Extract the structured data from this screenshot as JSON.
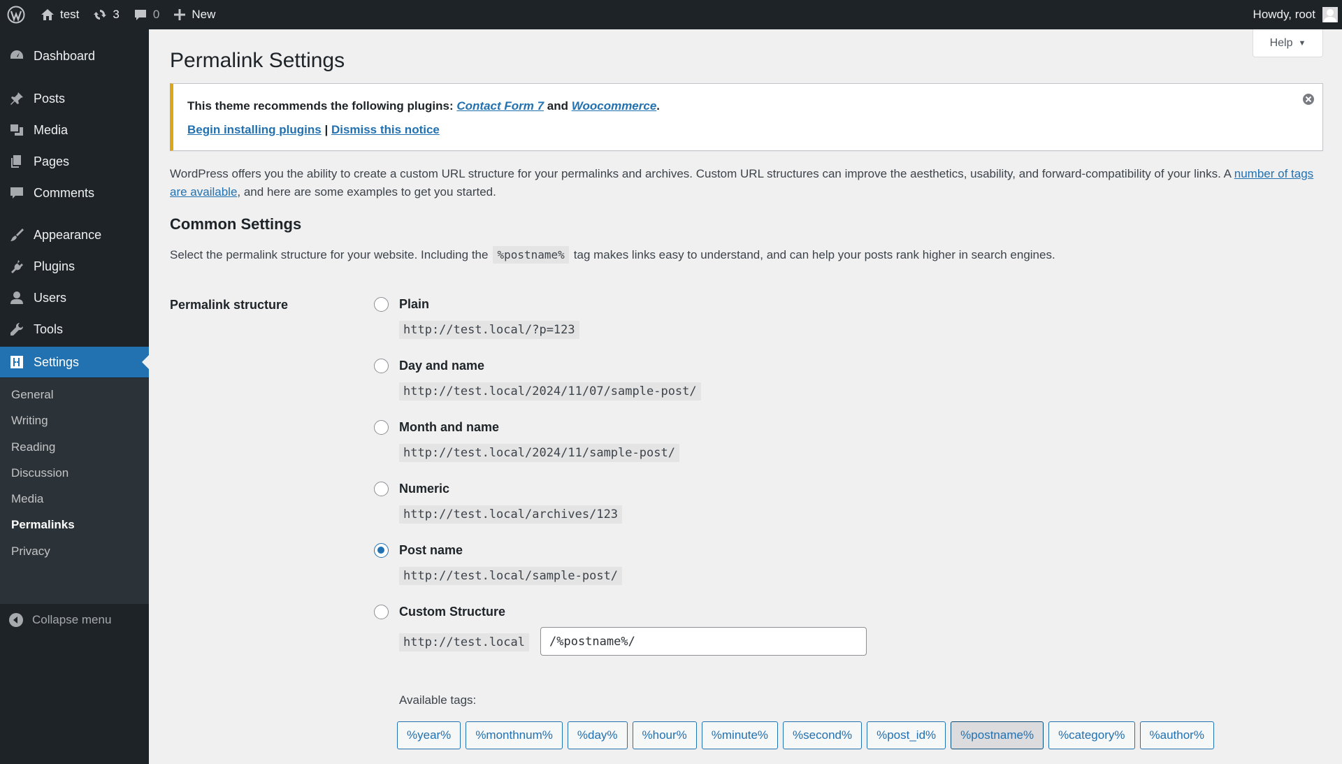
{
  "adminbar": {
    "site_name": "test",
    "updates_count": "3",
    "comments_count": "0",
    "new_label": "New",
    "howdy": "Howdy, root"
  },
  "sidebar": {
    "items": [
      {
        "label": "Dashboard",
        "icon": "dashboard-icon"
      },
      {
        "label": "Posts",
        "icon": "pin-icon"
      },
      {
        "label": "Media",
        "icon": "media-icon"
      },
      {
        "label": "Pages",
        "icon": "pages-icon"
      },
      {
        "label": "Comments",
        "icon": "comment-icon"
      },
      {
        "label": "Appearance",
        "icon": "brush-icon"
      },
      {
        "label": "Plugins",
        "icon": "plug-icon"
      },
      {
        "label": "Users",
        "icon": "user-icon"
      },
      {
        "label": "Tools",
        "icon": "wrench-icon"
      },
      {
        "label": "Settings",
        "icon": "settings-icon"
      }
    ],
    "submenu": [
      "General",
      "Writing",
      "Reading",
      "Discussion",
      "Media",
      "Permalinks",
      "Privacy"
    ],
    "collapse_label": "Collapse menu",
    "active_color": "#2271b1"
  },
  "help_label": "Help",
  "page_title": "Permalink Settings",
  "notice": {
    "text_before": "This theme recommends the following plugins: ",
    "plugin1": "Contact Form 7",
    "and": " and ",
    "plugin2": "Woocommerce",
    "period": ".",
    "begin_link": "Begin installing plugins",
    "separator": " | ",
    "dismiss_link": "Dismiss this notice",
    "accent": "#dba617"
  },
  "intro": {
    "text1": "WordPress offers you the ability to create a custom URL structure for your permalinks and archives. Custom URL structures can improve the aesthetics, usability, and forward-compatibility of your links. A ",
    "link": "number of tags are available",
    "text2": ", and here are some examples to get you started."
  },
  "common_heading": "Common Settings",
  "select_desc": {
    "before": "Select the permalink structure for your website. Including the",
    "code": "%postname%",
    "after": "tag makes links easy to understand, and can help your posts rank higher in search engines."
  },
  "structure_label": "Permalink structure",
  "options": [
    {
      "label": "Plain",
      "example": "http://test.local/?p=123",
      "checked": false
    },
    {
      "label": "Day and name",
      "example": "http://test.local/2024/11/07/sample-post/",
      "checked": false
    },
    {
      "label": "Month and name",
      "example": "http://test.local/2024/11/sample-post/",
      "checked": false
    },
    {
      "label": "Numeric",
      "example": "http://test.local/archives/123",
      "checked": false
    },
    {
      "label": "Post name",
      "example": "http://test.local/sample-post/",
      "checked": true
    },
    {
      "label": "Custom Structure",
      "example": "http://test.local",
      "checked": false
    }
  ],
  "custom_value": "/%postname%/",
  "available_tags_label": "Available tags:",
  "tags": [
    "%year%",
    "%monthnum%",
    "%day%",
    "%hour%",
    "%minute%",
    "%second%",
    "%post_id%",
    "%postname%",
    "%category%",
    "%author%"
  ],
  "selected_tag": "%postname%"
}
